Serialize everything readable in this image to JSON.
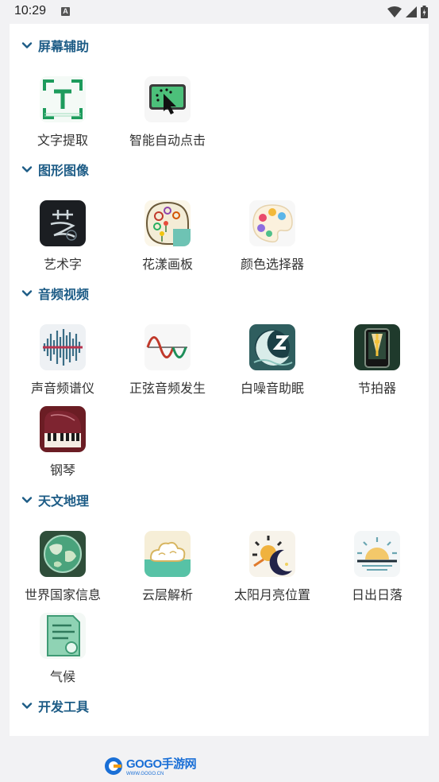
{
  "status_bar": {
    "time": "10:29",
    "notif_letter": "A"
  },
  "sections": [
    {
      "title": "屏幕辅助",
      "tools": [
        {
          "label": "文字提取",
          "icon": "text-extract-icon"
        },
        {
          "label": "智能自动点击",
          "icon": "auto-click-icon"
        }
      ]
    },
    {
      "title": "图形图像",
      "tools": [
        {
          "label": "艺术字",
          "icon": "art-text-icon"
        },
        {
          "label": "花漾画板",
          "icon": "flower-palette-icon"
        },
        {
          "label": "颜色选择器",
          "icon": "color-picker-icon"
        }
      ]
    },
    {
      "title": "音频视频",
      "tools": [
        {
          "label": "声音频谱仪",
          "icon": "sound-spectrum-icon"
        },
        {
          "label": "正弦音频发生",
          "icon": "sine-wave-icon"
        },
        {
          "label": "白噪音助眠",
          "icon": "white-noise-icon"
        },
        {
          "label": "节拍器",
          "icon": "metronome-icon"
        },
        {
          "label": "钢琴",
          "icon": "piano-icon"
        }
      ]
    },
    {
      "title": "天文地理",
      "tools": [
        {
          "label": "世界国家信息",
          "icon": "globe-icon"
        },
        {
          "label": "云层解析",
          "icon": "cloud-icon"
        },
        {
          "label": "太阳月亮位置",
          "icon": "sun-moon-icon"
        },
        {
          "label": "日出日落",
          "icon": "sunrise-icon"
        },
        {
          "label": "气候",
          "icon": "climate-document-icon"
        }
      ]
    },
    {
      "title": "开发工具",
      "tools": []
    }
  ],
  "footer": {
    "logo_text": "GOGO手游网",
    "logo_sub": "WWW.GOGO.CN"
  },
  "colors": {
    "section_title": "#1d5c86",
    "background": "#f2f2f4",
    "panel": "#ffffff"
  }
}
